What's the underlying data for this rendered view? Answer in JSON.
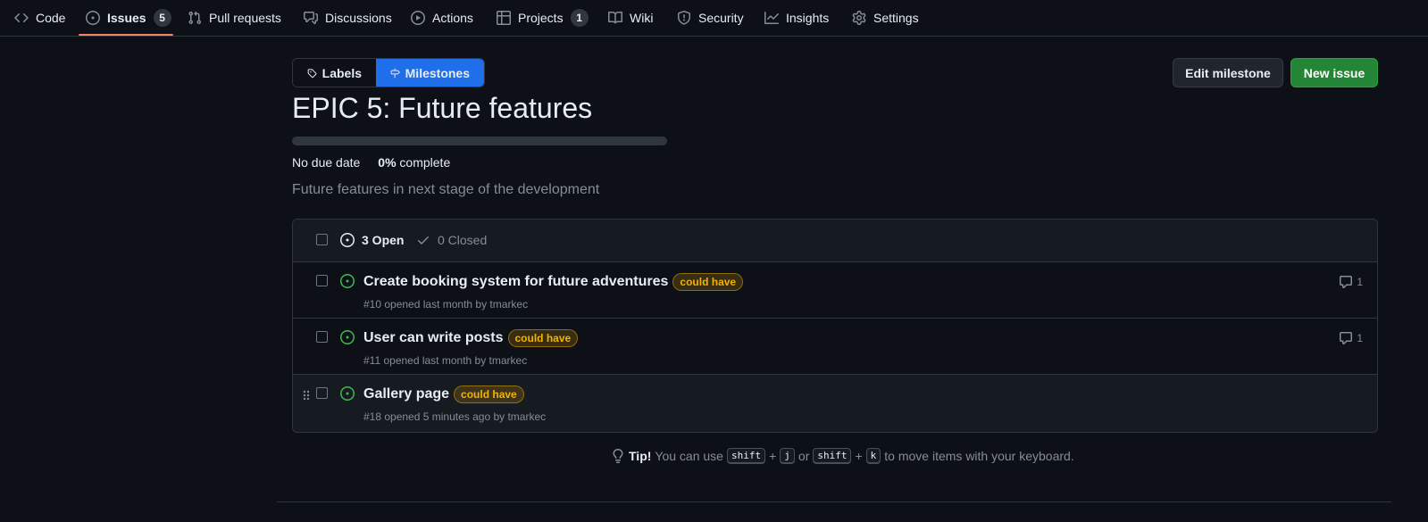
{
  "nav": {
    "items": [
      {
        "label": "Code",
        "icon": "code-icon"
      },
      {
        "label": "Issues",
        "icon": "issue-opened-icon",
        "count": "5",
        "selected": true
      },
      {
        "label": "Pull requests",
        "icon": "git-pull-request-icon"
      },
      {
        "label": "Discussions",
        "icon": "comment-discussion-icon"
      },
      {
        "label": "Actions",
        "icon": "play-icon"
      },
      {
        "label": "Projects",
        "icon": "table-icon",
        "count": "1"
      },
      {
        "label": "Wiki",
        "icon": "book-icon"
      },
      {
        "label": "Security",
        "icon": "shield-icon"
      },
      {
        "label": "Insights",
        "icon": "graph-icon"
      },
      {
        "label": "Settings",
        "icon": "gear-icon"
      }
    ]
  },
  "toolbar": {
    "labels_label": "Labels",
    "milestones_label": "Milestones",
    "edit_milestone_label": "Edit milestone",
    "new_issue_label": "New issue"
  },
  "milestone": {
    "title": "EPIC 5: Future features",
    "progress_percent": 0,
    "due": "No due date",
    "percent_text": "0%",
    "complete_text": "complete",
    "description": "Future features in next stage of the development"
  },
  "issues_header": {
    "open_text": "3 Open",
    "closed_text": "0 Closed"
  },
  "issues": [
    {
      "title": "Create booking system for future adventures",
      "label": "could have",
      "meta": "#10 opened last month by tmarkec",
      "comments": "1"
    },
    {
      "title": "User can write posts",
      "label": "could have",
      "meta": "#11 opened last month by tmarkec",
      "comments": "1"
    },
    {
      "title": "Gallery page",
      "label": "could have",
      "meta": "#18 opened 5 minutes ago by tmarkec",
      "comments": ""
    }
  ],
  "tip": {
    "bold": "Tip!",
    "text_1": "You can use",
    "key_shift": "shift",
    "plus": "+",
    "key_j": "j",
    "or": "or",
    "key_k": "k",
    "text_2": "to move items with your keyboard."
  },
  "colors": {
    "background": "#0d1117",
    "accent_blue": "#1f6feb",
    "success_green": "#238636",
    "open_icon_green": "#3fb950",
    "label_yellow": "#f0b400",
    "nav_underline": "#f78166"
  }
}
